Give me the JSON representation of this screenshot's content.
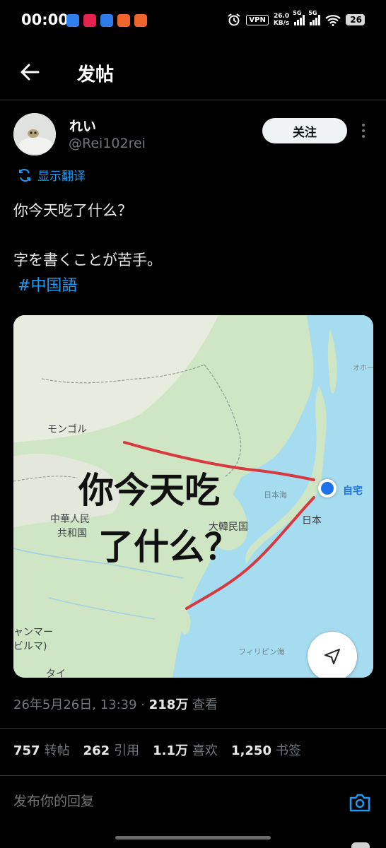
{
  "status_bar": {
    "time": "00:00",
    "vpn": "VPN",
    "speed_value": "26.0",
    "speed_unit": "KB/s",
    "network_1": "5G",
    "network_2": "5G",
    "battery": "26"
  },
  "header": {
    "title": "发帖"
  },
  "post": {
    "display_name": "れい",
    "handle": "@Rei102rei",
    "follow_label": "关注",
    "translate_label": "显示翻译",
    "text_line_1": "你今天吃了什么？",
    "text_line_2": "字を書くことが苦手。",
    "hashtag": "#中国語",
    "timestamp": "26年5月26日, 13:39 · ",
    "views_count": "218万",
    "views_label": " 查看"
  },
  "map": {
    "labels": {
      "mongolia": "モンゴル",
      "china_1": "中華人民",
      "china_2": "共和国",
      "korea": "大韓民国",
      "japan": "日本",
      "sea_of_japan": "日本海",
      "philippine_sea": "フィリピン海",
      "okhotsk": "オホー",
      "myanmar_1": "ャンマー",
      "myanmar_2": "ビルマ)",
      "thailand": "タイ",
      "home": "自宅"
    },
    "handwriting": {
      "line_1": "你今天吃",
      "line_2": "了什么？"
    },
    "colors": {
      "water": "#a6dcef",
      "land": "#cde6c3",
      "drawn_line": "#d8383f"
    }
  },
  "stats": [
    {
      "count": "757",
      "label": "转帖"
    },
    {
      "count": "262",
      "label": "引用"
    },
    {
      "count": "1.1万",
      "label": "喜欢"
    },
    {
      "count": "1,250",
      "label": "书签"
    }
  ],
  "reply": {
    "placeholder": "发布你的回复"
  },
  "colors": {
    "accent": "#1d9bf0",
    "background": "#000000",
    "muted": "#71767b"
  }
}
